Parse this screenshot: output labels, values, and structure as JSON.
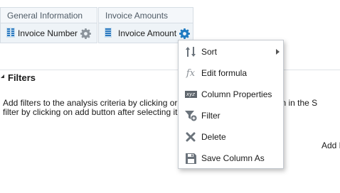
{
  "criteria": {
    "columns": [
      {
        "header": "General Information",
        "item_label": "Invoice Number",
        "item_icon": "measure-column-icon",
        "action_icon": "gear-icon"
      },
      {
        "header": "Invoice Amounts",
        "item_label": "Invoice Amount",
        "item_icon": "measure-column-icon",
        "action_icon": "gear-icon"
      }
    ]
  },
  "filters": {
    "title": "Filters",
    "help_line1": "Add filters to the analysis criteria by clicking or",
    "help_line2": "filter by clicking on add button after selecting it",
    "help_line1_tail": "column in the S",
    "add_label": "Add F"
  },
  "context_menu": {
    "items": [
      {
        "label": "Sort",
        "icon": "sort-icon",
        "has_submenu": true
      },
      {
        "label": "Edit formula",
        "icon": "formula-fx-icon"
      },
      {
        "label": "Column Properties",
        "icon": "column-properties-xyz-icon"
      },
      {
        "label": "Filter",
        "icon": "filter-icon"
      },
      {
        "label": "Delete",
        "icon": "delete-x-icon"
      },
      {
        "label": "Save Column As",
        "icon": "save-disk-icon"
      }
    ]
  },
  "colors": {
    "accent_blue": "#1f7bc1",
    "panel_bg": "#eef3f7",
    "border": "#d6dde4"
  }
}
